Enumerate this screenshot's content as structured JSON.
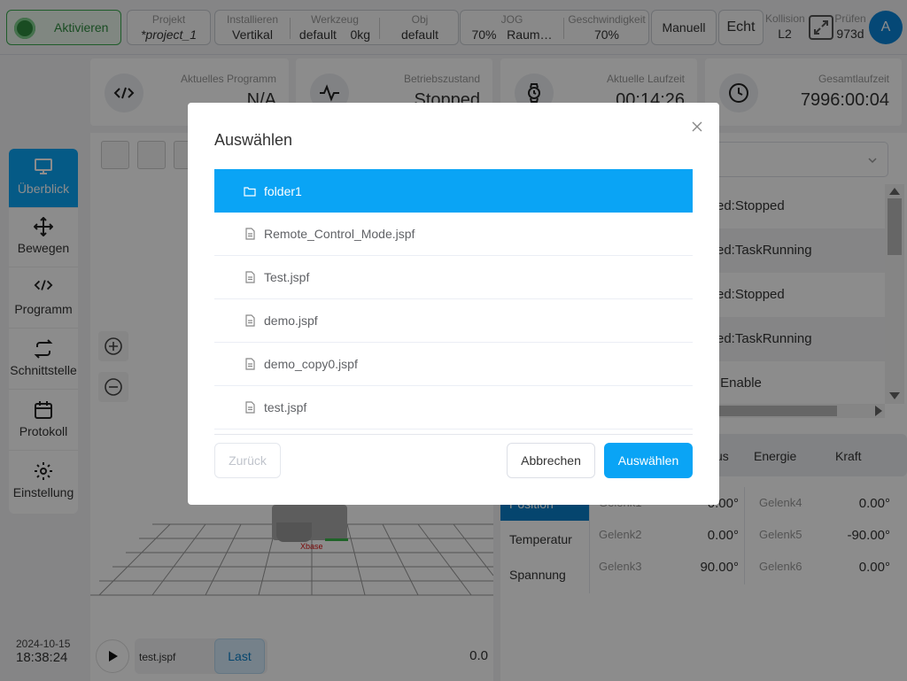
{
  "topbar": {
    "activate_label": "Aktivieren",
    "project": {
      "label": "Projekt",
      "value": "*project_1"
    },
    "install": {
      "label": "Installieren",
      "value": "Vertikal"
    },
    "tool": {
      "label": "Werkzeug",
      "name": "default",
      "weight": "0kg"
    },
    "obj": {
      "label": "Obj",
      "value": "default"
    },
    "jog": {
      "label": "JOG",
      "value": "70%",
      "mode": "Raum…"
    },
    "speed": {
      "label": "Geschwindigkeit",
      "value": "70%"
    },
    "manual_label": "Manuell",
    "real_label": "Echt",
    "collision": {
      "label": "Kollision",
      "value": "L2"
    },
    "check": {
      "label": "Prüfen",
      "value": "973d"
    },
    "avatar": "A"
  },
  "cards": [
    {
      "label": "Aktuelles Programm",
      "value": "N/A",
      "icon": "code-icon"
    },
    {
      "label": "Betriebszustand",
      "value": "Stopped",
      "icon": "pulse-icon"
    },
    {
      "label": "Aktuelle Laufzeit",
      "value": "00:14:26",
      "icon": "watch-icon"
    },
    {
      "label": "Gesamtlaufzeit",
      "value": "7996:00:04",
      "icon": "clock-icon"
    }
  ],
  "sidebar": {
    "items": [
      {
        "label": "Überblick",
        "icon": "monitor-icon"
      },
      {
        "label": "Bewegen",
        "icon": "move-icon"
      },
      {
        "label": "Programm",
        "icon": "code-icon"
      },
      {
        "label": "Schnittstelle",
        "icon": "swap-icon"
      },
      {
        "label": "Protokoll",
        "icon": "calendar-icon"
      },
      {
        "label": "Einstellung",
        "icon": "gear-icon"
      }
    ]
  },
  "viewer": {
    "x_axis_label": "Xbase",
    "play_program": "test.jspf",
    "load_label": "Last",
    "speed_value": "0.0"
  },
  "clock": {
    "date": "2024-10-15",
    "time": "18:38:24"
  },
  "log": {
    "entries": [
      "ed:Stopped",
      "ed:TaskRunning",
      "ed:Stopped",
      "ed:TaskRunning",
      ":Enable"
    ]
  },
  "tabs": {
    "status": "us",
    "energy": "Energie",
    "force": "Kraft"
  },
  "left_tabs": [
    "Position",
    "Temperatur",
    "Spannung"
  ],
  "joints": [
    {
      "name": "Gelenk1",
      "value": "0.00°"
    },
    {
      "name": "Gelenk2",
      "value": "0.00°"
    },
    {
      "name": "Gelenk3",
      "value": "90.00°"
    },
    {
      "name": "Gelenk4",
      "value": "0.00°"
    },
    {
      "name": "Gelenk5",
      "value": "-90.00°"
    },
    {
      "name": "Gelenk6",
      "value": "0.00°"
    }
  ],
  "modal": {
    "title": "Auswählen",
    "files": [
      {
        "name": "folder1",
        "type": "folder",
        "selected": true
      },
      {
        "name": "Remote_Control_Mode.jspf",
        "type": "file"
      },
      {
        "name": "Test.jspf",
        "type": "file"
      },
      {
        "name": "demo.jspf",
        "type": "file"
      },
      {
        "name": "demo_copy0.jspf",
        "type": "file"
      },
      {
        "name": "test.jspf",
        "type": "file"
      }
    ],
    "back_label": "Zurück",
    "cancel_label": "Abbrechen",
    "select_label": "Auswählen"
  },
  "colors": {
    "accent": "#0aa4f5",
    "activate_green": "#3aa84e",
    "bg": "#f2f3f5"
  }
}
